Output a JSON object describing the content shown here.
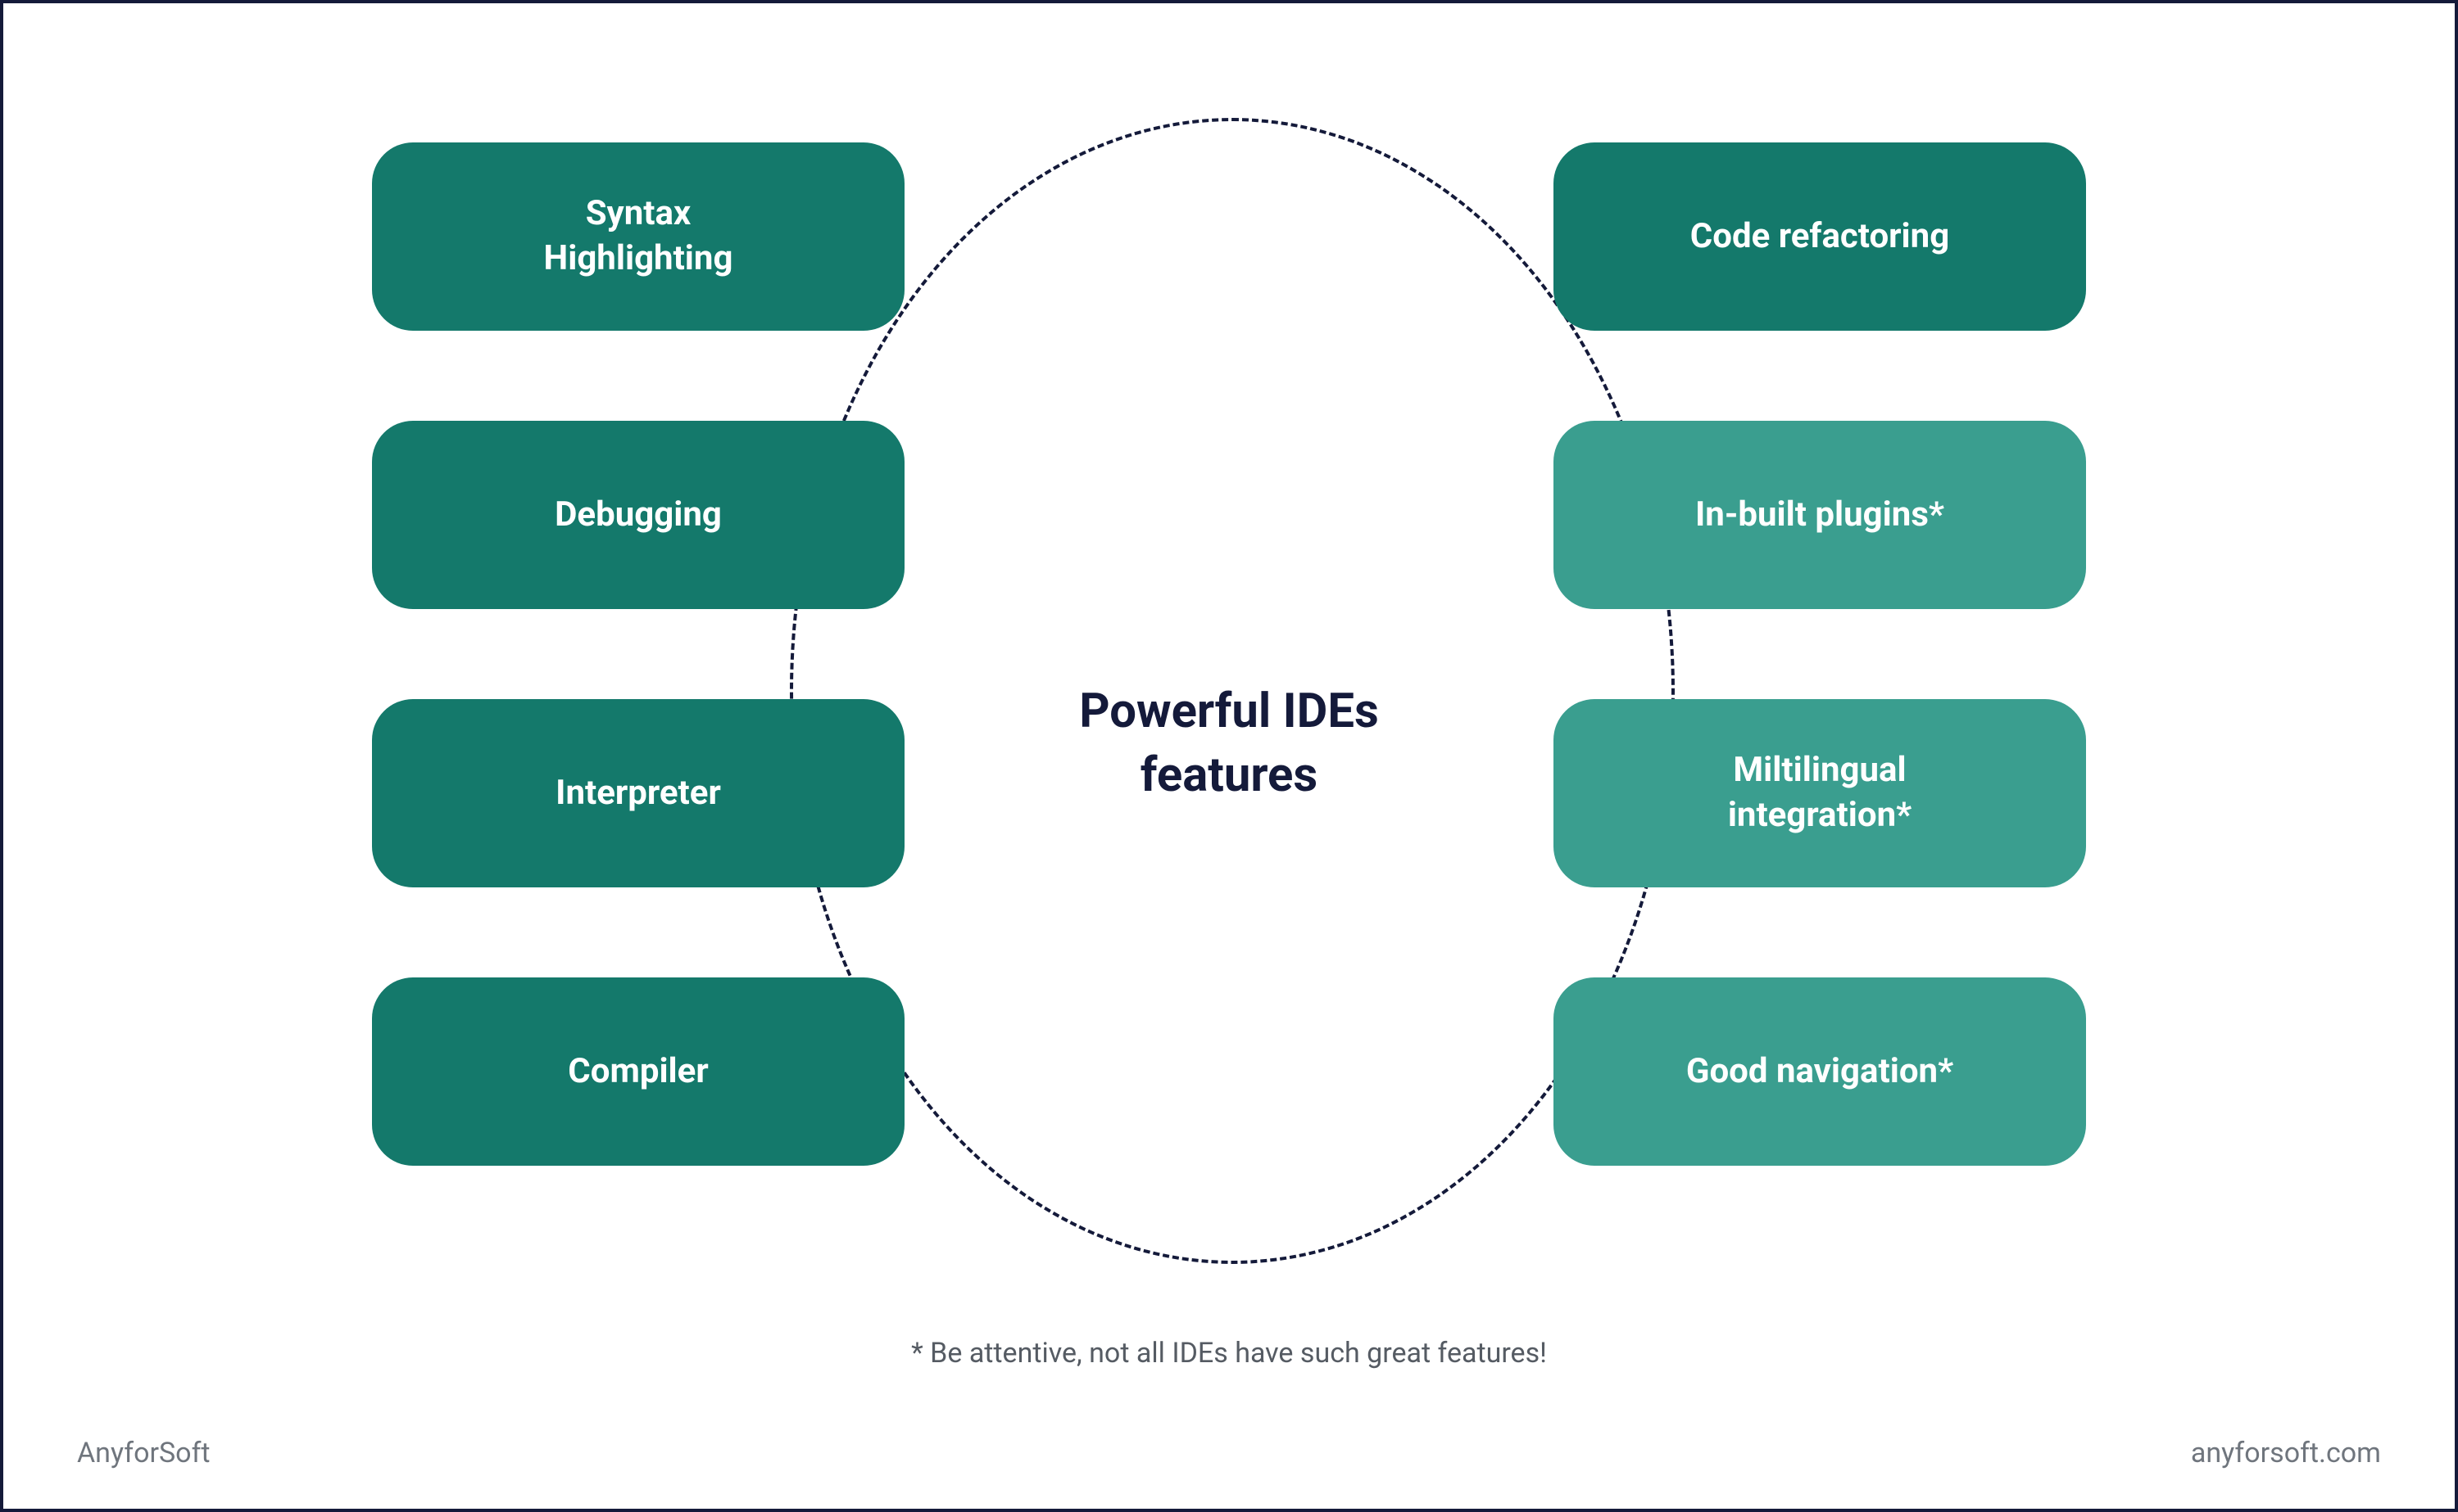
{
  "title_line1": "Powerful IDEs",
  "title_line2": "features",
  "left_features": [
    {
      "label": "Syntax\nHighlighting",
      "shade": "dark"
    },
    {
      "label": "Debugging",
      "shade": "dark"
    },
    {
      "label": "Interpreter",
      "shade": "dark"
    },
    {
      "label": "Compiler",
      "shade": "dark"
    }
  ],
  "right_features": [
    {
      "label": "Code refactoring",
      "shade": "dark"
    },
    {
      "label": "In-built plugins*",
      "shade": "light"
    },
    {
      "label": "Miltilingual\nintegration*",
      "shade": "light"
    },
    {
      "label": "Good navigation*",
      "shade": "light"
    }
  ],
  "footnote": "* Be attentive, not all IDEs have such great features!",
  "brand": "AnyforSoft",
  "url": "anyforsoft.com",
  "colors": {
    "frame_border": "#141a3a",
    "feature_dark": "#14796b",
    "feature_light": "#3a9e8f"
  }
}
